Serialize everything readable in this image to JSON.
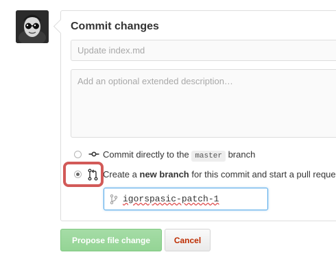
{
  "commit": {
    "title": "Commit changes",
    "summary_placeholder": "Update index.md",
    "description_placeholder": "Add an optional extended description…"
  },
  "options": {
    "direct": {
      "prefix": "Commit directly to the",
      "branch": "master",
      "suffix": "branch",
      "selected": false
    },
    "new_branch": {
      "prefix": "Create a",
      "emphasis": "new branch",
      "suffix": "for this commit and start a pull reque",
      "selected": true
    }
  },
  "branch_name": {
    "value": "igorspasic-patch-1"
  },
  "buttons": {
    "propose": "Propose file change",
    "cancel": "Cancel"
  },
  "colors": {
    "propose_bg": "#a5dca6",
    "cancel_text": "#bd2c00",
    "highlight": "#d25a58",
    "focus_border": "#51a7e8"
  },
  "icons": {
    "commit": "git-commit-icon",
    "pull_request": "git-pull-request-icon",
    "branch": "git-branch-icon"
  }
}
